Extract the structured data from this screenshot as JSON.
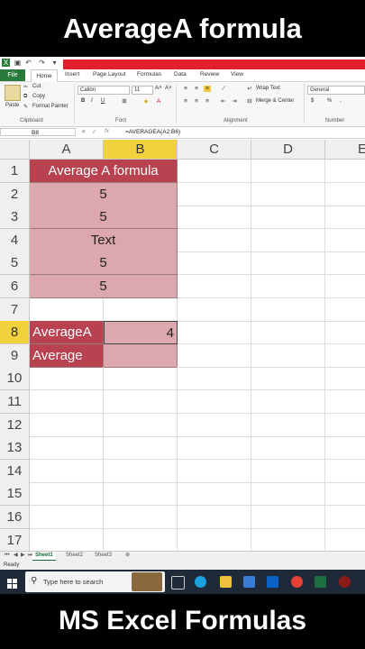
{
  "captions": {
    "top": "AverageA formula",
    "bottom": "MS Excel Formulas"
  },
  "ribbon": {
    "tabs": [
      "File",
      "Home",
      "Insert",
      "Page Layout",
      "Formulas",
      "Data",
      "Review",
      "View"
    ],
    "clipboard": {
      "paste": "Paste",
      "cut": "Cut",
      "copy": "Copy",
      "format_painter": "Format Painter",
      "group": "Clipboard"
    },
    "font": {
      "name": "Calibri",
      "size": "11",
      "group": "Font",
      "bold": "B",
      "italic": "I",
      "underline": "U",
      "grow": "A˄",
      "shrink": "A˅"
    },
    "alignment": {
      "wrap": "Wrap Text",
      "merge": "Merge & Center",
      "group": "Alignment"
    },
    "number": {
      "format": "General",
      "currency": "$",
      "percent": "%",
      "comma": ",",
      "group": "Number"
    }
  },
  "formula_bar": {
    "name_box": "B8",
    "formula": "=AVERAGEA(A2:B6)"
  },
  "columns": [
    "A",
    "B",
    "C",
    "D",
    "E"
  ],
  "rows": [
    "1",
    "2",
    "3",
    "4",
    "5",
    "6",
    "7",
    "8",
    "9",
    "10",
    "11",
    "12",
    "13",
    "14",
    "15",
    "16",
    "17"
  ],
  "cells": {
    "A1": "Average A formula",
    "A2": "5",
    "A3": "5",
    "A4": "Text",
    "A5": "5",
    "A6": "5",
    "A8": "AverageA",
    "B8": "4",
    "A9": "Average"
  },
  "sheet_tabs": [
    "Sheet1",
    "Sheet2",
    "Sheet3"
  ],
  "status": "Ready",
  "taskbar": {
    "search_placeholder": "Type here to search"
  },
  "colors": {
    "header_fill": "#b8424f",
    "data_fill": "#dda7ae",
    "selected_col_header": "#f2d23c",
    "file_tab": "#2a7a3c",
    "taskbar": "#1f2a38"
  }
}
